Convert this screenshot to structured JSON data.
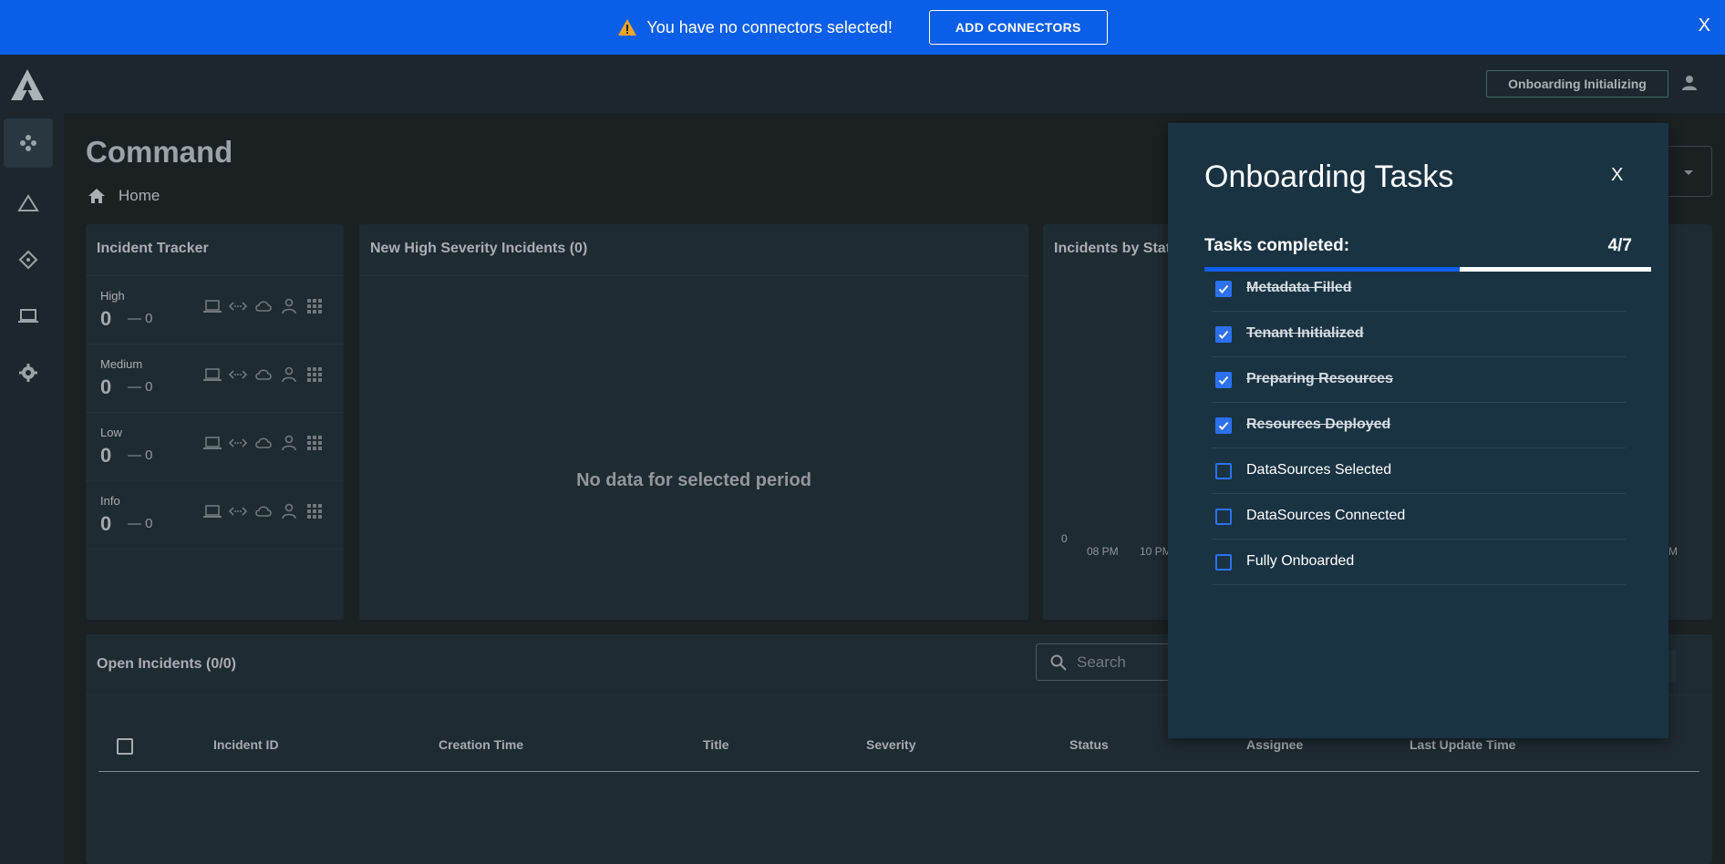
{
  "banner": {
    "message": "You have no connectors selected!",
    "add_button": "ADD CONNECTORS",
    "close": "X"
  },
  "topbar": {
    "onboarding_button": "Onboarding Initializing"
  },
  "sidebar": {
    "items": [
      {
        "icon": "command-icon",
        "active": true
      },
      {
        "icon": "incidents-triangle-icon",
        "active": false
      },
      {
        "icon": "connectors-icon",
        "active": false
      },
      {
        "icon": "devices-laptop-icon",
        "active": false
      },
      {
        "icon": "settings-gear-icon",
        "active": false
      }
    ]
  },
  "header": {
    "title": "Command",
    "breadcrumb": "Home"
  },
  "incident_tracker": {
    "title": "Incident Tracker",
    "rows": [
      {
        "label": "High",
        "count": "0",
        "delta": "— 0"
      },
      {
        "label": "Medium",
        "count": "0",
        "delta": "— 0"
      },
      {
        "label": "Low",
        "count": "0",
        "delta": "— 0"
      },
      {
        "label": "Info",
        "count": "0",
        "delta": "— 0"
      }
    ],
    "row_icons": [
      "laptop-icon",
      "network-icon",
      "cloud-icon",
      "person-icon",
      "apps-grid-icon"
    ]
  },
  "high_severity": {
    "title": "New High Severity Incidents (0)",
    "empty_message": "No data for selected period"
  },
  "incidents_by_status": {
    "title": "Incidents by Stat",
    "y_zero": "0",
    "x_ticks": [
      "08 PM",
      "10 PM",
      "M"
    ]
  },
  "open_incidents": {
    "title": "Open Incidents (0/0)",
    "search_placeholder": "Search",
    "columns": [
      "Incident ID",
      "Creation Time",
      "Title",
      "Severity",
      "Status",
      "Assignee",
      "Last Update Time"
    ]
  },
  "onboarding_panel": {
    "title": "Onboarding Tasks",
    "close": "X",
    "tasks_label": "Tasks completed:",
    "tasks_count": "4/7",
    "progress_fraction": 0.571,
    "tasks": [
      {
        "label": "Metadata Filled",
        "done": true
      },
      {
        "label": "Tenant Initialized",
        "done": true
      },
      {
        "label": "Preparing Resources",
        "done": true
      },
      {
        "label": "Resources Deployed",
        "done": true
      },
      {
        "label": "DataSources Selected",
        "done": false
      },
      {
        "label": "DataSources Connected",
        "done": false
      },
      {
        "label": "Fully Onboarded",
        "done": false
      }
    ]
  },
  "colors": {
    "banner_blue": "#0b5ee8",
    "panel_bg": "#1a3343",
    "warning_orange": "#f5a623"
  }
}
